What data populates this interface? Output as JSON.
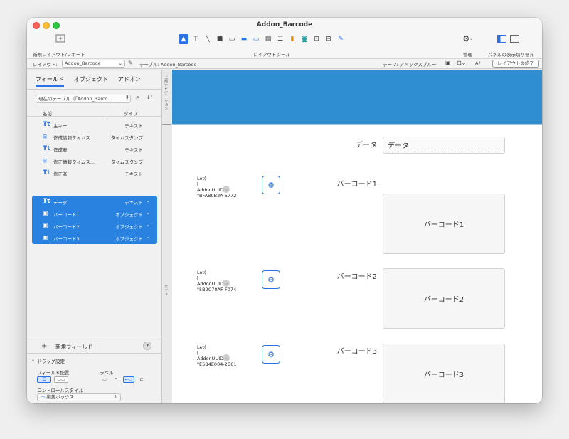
{
  "window": {
    "title": "Addon_Barcode"
  },
  "toolbar": {
    "new_layout_label": "新規レイアウト/レポート",
    "layout_tools_label": "レイアウトツール",
    "manage_label": "管理",
    "panel_toggle_label": "パネルの表示切り替え"
  },
  "layout_bar": {
    "layout_prefix": "レイアウト:",
    "layout_name": "Addon_Barcode",
    "table_label": "テーブル: Addon_Barcode",
    "theme_label": "テーマ: アペックスブルー",
    "aa_label": "Aª",
    "exit_button": "レイアウトの終了"
  },
  "left_panel": {
    "tabs": [
      "フィールド",
      "オブジェクト",
      "アドオン"
    ],
    "table_select": "現在のテーブル（「Addon_Barco...",
    "col_name": "名前",
    "col_type": "タイプ",
    "fields": [
      {
        "icon": "Tt",
        "name": "主キー",
        "type": "テキスト"
      },
      {
        "icon": "ts",
        "name": "作成情報タイムス...",
        "type": "タイムスタンプ"
      },
      {
        "icon": "Tt",
        "name": "作成者",
        "type": "テキスト"
      },
      {
        "icon": "ts",
        "name": "修正情報タイムス...",
        "type": "タイムスタンプ"
      },
      {
        "icon": "Tt",
        "name": "修正者",
        "type": "テキスト"
      },
      {
        "icon": "Tt",
        "name": "データ",
        "type": "テキスト"
      },
      {
        "icon": "img",
        "name": "バーコード1",
        "type": "オブジェクト"
      },
      {
        "icon": "img",
        "name": "バーコード2",
        "type": "オブジェクト"
      },
      {
        "icon": "img",
        "name": "バーコード3",
        "type": "オブジェクト"
      }
    ],
    "new_field": "新規フィールド",
    "help": "?",
    "drag_settings": "ドラッグ設定",
    "field_placement": "フィールド配置",
    "label": "ラベル",
    "control_style": "コントロールスタイル",
    "control_value": "編集ボックス"
  },
  "parts": {
    "header": "上部ナビゲーション",
    "body": "ボディ"
  },
  "canvas": {
    "data_label": "データ",
    "data_field": "データ",
    "barcodes": [
      {
        "label": "バーコード1",
        "box": "バーコード1",
        "calc": [
          "Let(",
          "[",
          "AddonUUID =",
          "\"BFAB9B2A-5772"
        ]
      },
      {
        "label": "バーコード2",
        "box": "バーコード2",
        "calc": [
          "Let(",
          "[",
          "AddonUUID =",
          "\"5B9C70AF-F074"
        ]
      },
      {
        "label": "バーコード3",
        "box": "バーコード3",
        "calc": [
          "Let(",
          "[",
          "AddonUUID =",
          "\"E5B4E004-2B61"
        ]
      }
    ]
  }
}
